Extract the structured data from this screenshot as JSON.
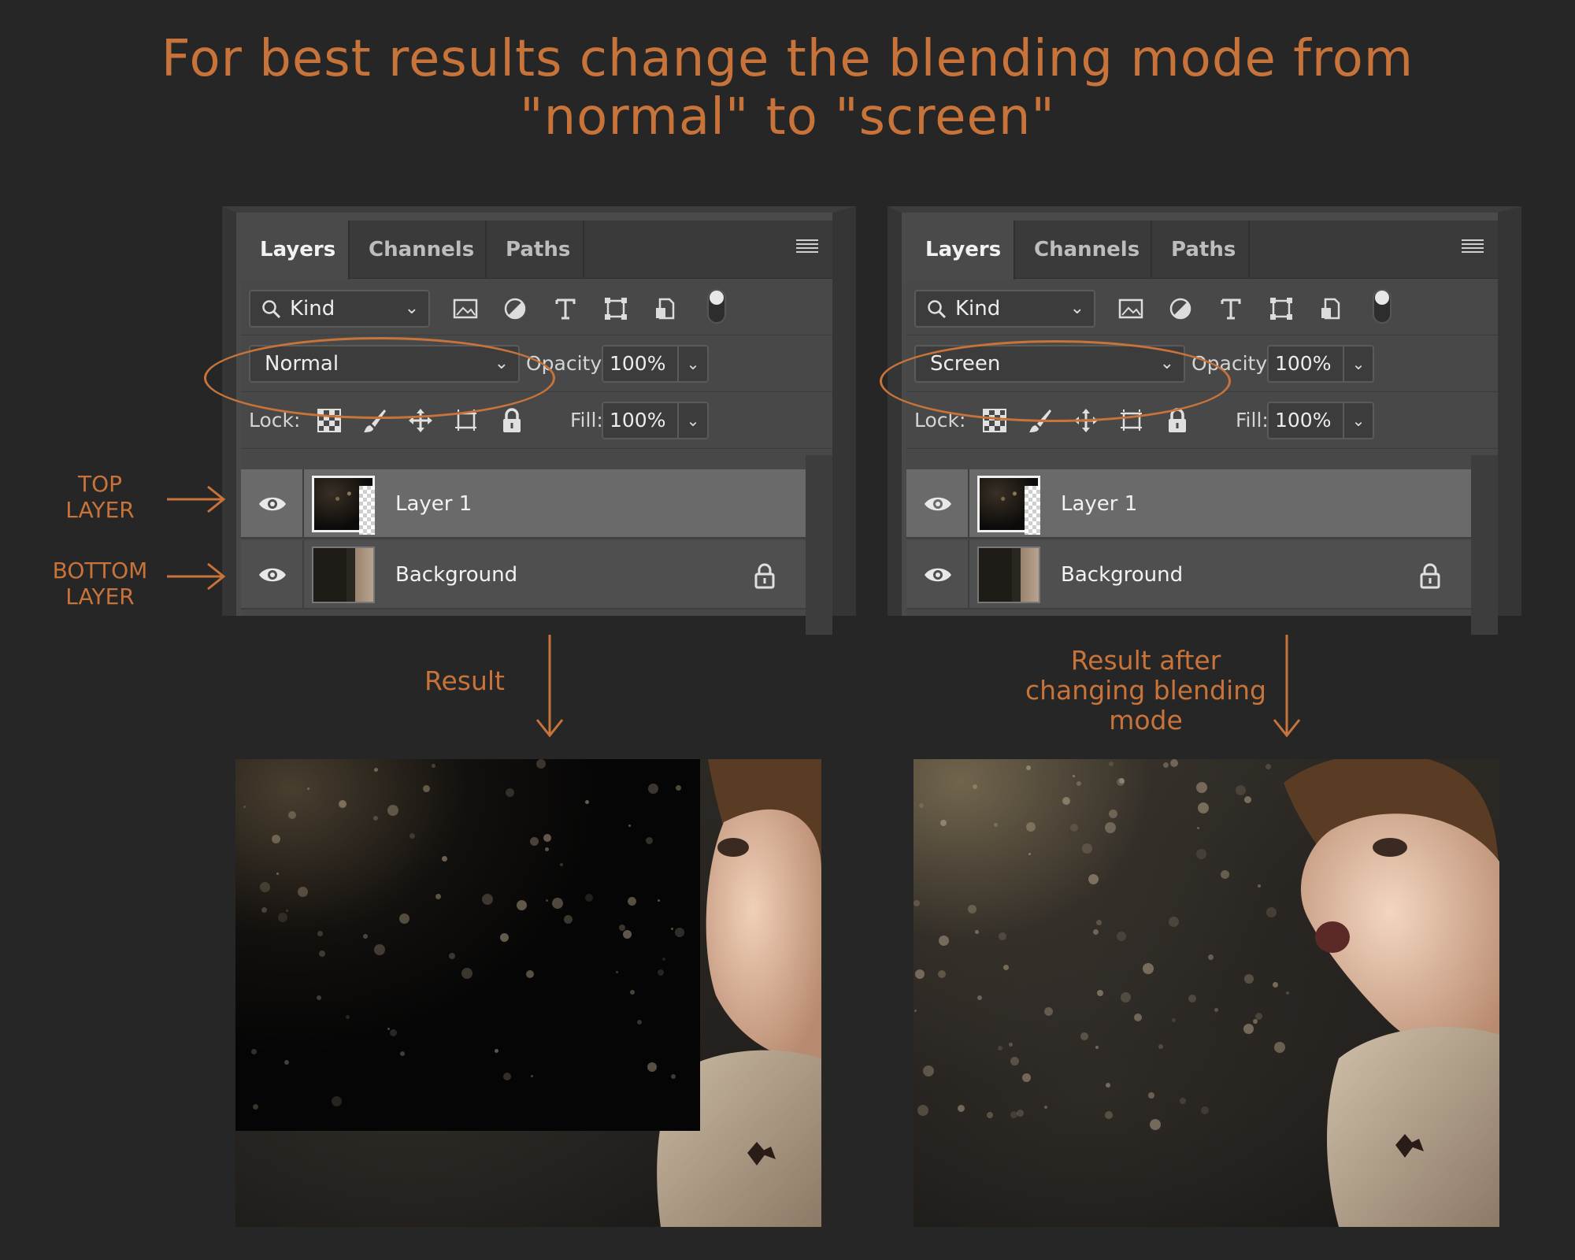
{
  "headline": {
    "line1": "For best results change the blending mode from",
    "line2": "\"normal\" to \"screen\""
  },
  "panels": [
    {
      "tabs": [
        "Layers",
        "Channels",
        "Paths"
      ],
      "filter": "Kind",
      "blend_mode": "Normal",
      "opacity_label": "Opacity:",
      "opacity": "100%",
      "lock_label": "Lock:",
      "fill_label": "Fill:",
      "fill": "100%",
      "layers": [
        {
          "name": "Layer 1",
          "selected": true
        },
        {
          "name": "Background",
          "locked": true
        }
      ]
    },
    {
      "tabs": [
        "Layers",
        "Channels",
        "Paths"
      ],
      "filter": "Kind",
      "blend_mode": "Screen",
      "opacity_label": "Opacity:",
      "opacity": "100%",
      "lock_label": "Lock:",
      "fill_label": "Fill:",
      "fill": "100%",
      "layers": [
        {
          "name": "Layer 1",
          "selected": true
        },
        {
          "name": "Background",
          "locked": true
        }
      ]
    }
  ],
  "annotations": {
    "top_layer": [
      "TOP",
      "LAYER"
    ],
    "bottom_layer": [
      "BOTTOM",
      "LAYER"
    ],
    "result": "Result",
    "result_after": [
      "Result after",
      "changing blending",
      "mode"
    ]
  },
  "colors": {
    "accent": "#c8733a",
    "background": "#262626",
    "panel": "#4a4a4a"
  }
}
